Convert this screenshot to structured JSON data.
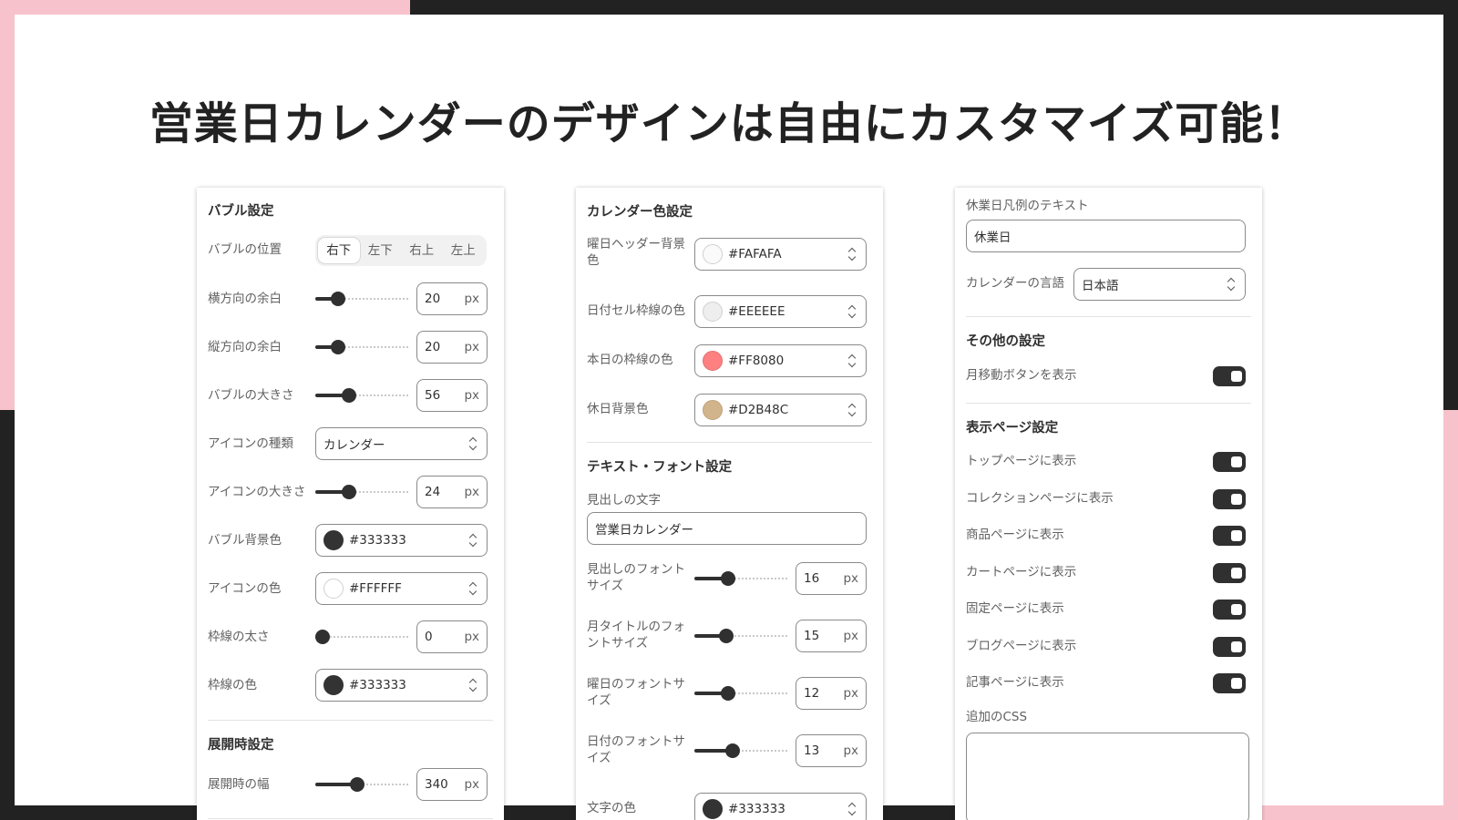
{
  "title": "営業日カレンダーのデザインは自由にカスタマイズ可能！",
  "bubble": {
    "section": "バブル設定",
    "position_label": "バブルの位置",
    "position_options": [
      "右下",
      "左下",
      "右上",
      "左上"
    ],
    "position_selected": "右下",
    "h_margin_label": "横方向の余白",
    "h_margin": "20",
    "v_margin_label": "縦方向の余白",
    "v_margin": "20",
    "size_label": "バブルの大きさ",
    "size": "56",
    "icon_type_label": "アイコンの種類",
    "icon_type": "カレンダー",
    "icon_size_label": "アイコンの大きさ",
    "icon_size": "24",
    "bg_label": "バブル背景色",
    "bg": "#333333",
    "icon_color_label": "アイコンの色",
    "icon_color": "#FFFFFF",
    "border_width_label": "枠線の太さ",
    "border_width": "0",
    "border_color_label": "枠線の色",
    "border_color": "#333333",
    "unit": "px"
  },
  "expand": {
    "section": "展開時設定",
    "width_label": "展開時の幅",
    "width": "340"
  },
  "calendar_colors": {
    "section": "カレンダー色設定",
    "header_bg_label": "曜日ヘッダー背景色",
    "header_bg": "#FAFAFA",
    "cell_border_label": "日付セル枠線の色",
    "cell_border": "#EEEEEE",
    "today_border_label": "本日の枠線の色",
    "today_border": "#FF8080",
    "holiday_bg_label": "休日背景色",
    "holiday_bg": "#D2B48C"
  },
  "text_font": {
    "section": "テキスト・フォント設定",
    "heading_label": "見出しの文字",
    "heading": "営業日カレンダー",
    "heading_size_label": "見出しのフォントサイズ",
    "heading_size": "16",
    "month_size_label": "月タイトルのフォントサイズ",
    "month_size": "15",
    "weekday_size_label": "曜日のフォントサイズ",
    "weekday_size": "12",
    "date_size_label": "日付のフォントサイズ",
    "date_size": "13",
    "text_color_label": "文字の色",
    "text_color": "#333333",
    "unit": "px"
  },
  "misc": {
    "legend_label": "休業日凡例のテキスト",
    "legend": "休業日",
    "lang_label": "カレンダーの言語",
    "lang": "日本語",
    "other_section": "その他の設定",
    "month_nav_label": "月移動ボタンを表示",
    "pages_section": "表示ページ設定",
    "pages": [
      "トップページに表示",
      "コレクションページに表示",
      "商品ページに表示",
      "カートページに表示",
      "固定ページに表示",
      "ブログページに表示",
      "記事ページに表示"
    ],
    "css_label": "追加のCSS"
  },
  "colors": {
    "pink": "#F7C2CC",
    "dark": "#222222",
    "swatch_333333": "#333333",
    "swatch_ffffff": "#FFFFFF",
    "swatch_fafafa": "#FAFAFA",
    "swatch_eeeeee": "#EEEEEE",
    "swatch_ff8080": "#FF8080",
    "swatch_d2b48c": "#D2B48C"
  }
}
